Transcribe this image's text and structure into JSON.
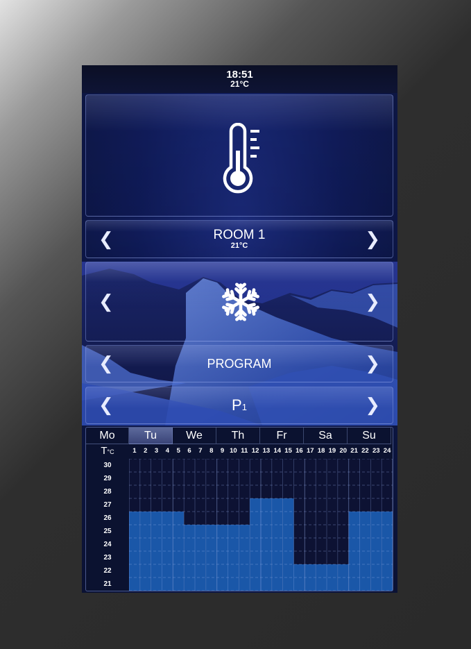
{
  "status": {
    "time": "18:51",
    "temp": "21°C"
  },
  "main_icon": "thermometer-icon",
  "room": {
    "name": "ROOM 1",
    "temp": "21°C"
  },
  "mode_icon": "snowflake-icon",
  "program": {
    "label": "PROGRAM"
  },
  "profile": {
    "label": "P",
    "index": "1"
  },
  "schedule": {
    "days": [
      "Mo",
      "Tu",
      "We",
      "Th",
      "Fr",
      "Sa",
      "Su"
    ],
    "selected_day": "Tu",
    "temp_axis_label": "T",
    "temp_unit": "°C",
    "hours": [
      "1",
      "2",
      "3",
      "4",
      "5",
      "6",
      "7",
      "8",
      "9",
      "10",
      "11",
      "12",
      "13",
      "14",
      "15",
      "16",
      "17",
      "18",
      "19",
      "20",
      "21",
      "22",
      "23",
      "24"
    ],
    "temps": [
      "30",
      "29",
      "28",
      "27",
      "26",
      "25",
      "24",
      "23",
      "22",
      "21"
    ],
    "setpoints": [
      26,
      26,
      26,
      26,
      26,
      25,
      25,
      25,
      25,
      25,
      25,
      27,
      27,
      27,
      27,
      22,
      22,
      22,
      22,
      22,
      26,
      26,
      26,
      26
    ],
    "colors": {
      "active": "#1a57a8",
      "inactive": "#0d1233",
      "grid_line": "rgba(150,175,235,0.45)"
    }
  }
}
